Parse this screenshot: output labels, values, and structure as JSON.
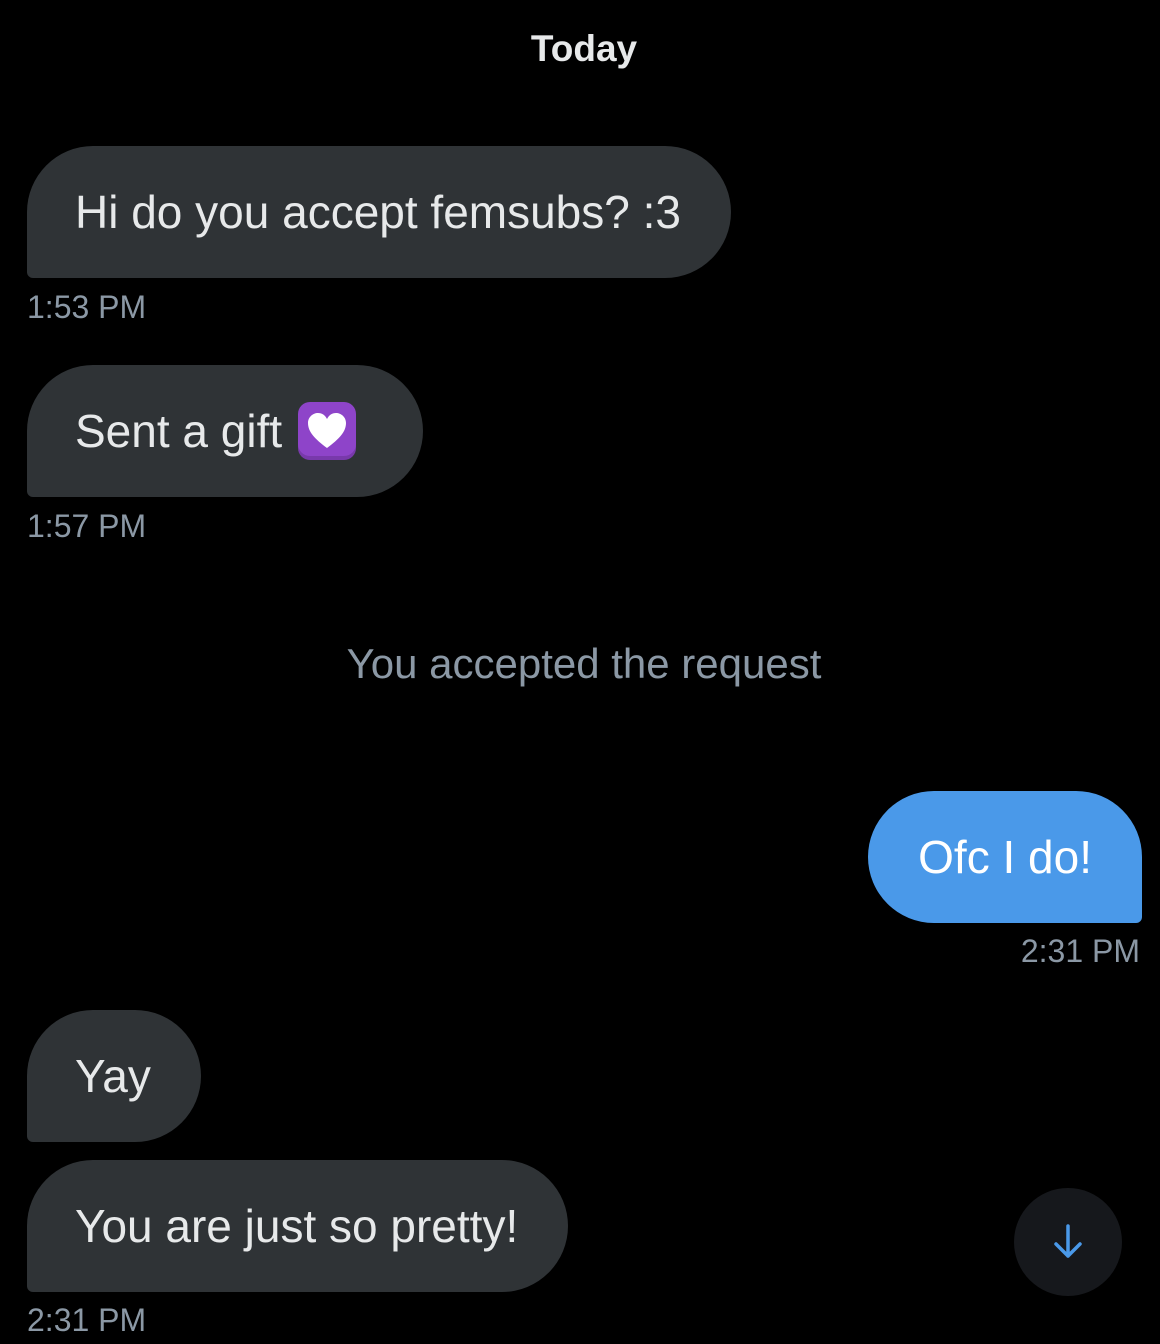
{
  "conversation": {
    "day_label": "Today",
    "system_message": "You accepted the request",
    "messages": [
      {
        "direction": "incoming",
        "text": "Hi do you accept femsubs? :3",
        "time": "1:53 PM"
      },
      {
        "direction": "incoming",
        "text": "Sent a gift",
        "emoji": "purple-heart-emoji",
        "time": "1:57 PM"
      },
      {
        "direction": "outgoing",
        "text": "Ofc I do!",
        "time": "2:31 PM"
      },
      {
        "direction": "incoming",
        "text": "Yay",
        "time": ""
      },
      {
        "direction": "incoming",
        "text": "You are just so pretty!",
        "time": "2:31 PM"
      }
    ]
  },
  "controls": {
    "scroll_down_icon": "arrow-down-icon"
  },
  "colors": {
    "background": "#000000",
    "incoming_bubble": "#2f3336",
    "outgoing_bubble": "#4a99e9",
    "secondary_text": "#8b98a5",
    "accent": "#4a99e9"
  }
}
